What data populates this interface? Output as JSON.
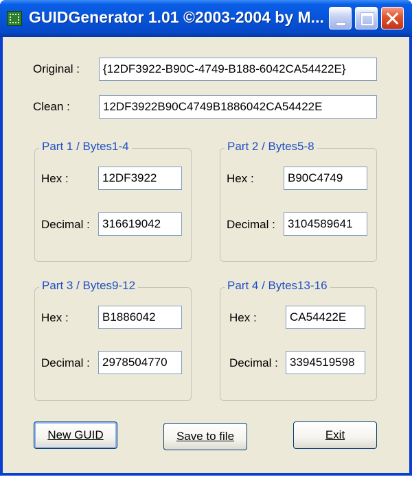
{
  "window": {
    "title": "GUIDGenerator 1.01 ©2003-2004 by M..."
  },
  "original": {
    "label": "Original :",
    "value": "{12DF3922-B90C-4749-B188-6042CA54422E}"
  },
  "clean": {
    "label": "Clean :",
    "value": "12DF3922B90C4749B1886042CA54422E"
  },
  "parts": [
    {
      "title": "Part 1 / Bytes1-4",
      "hex_label": "Hex :",
      "hex": "12DF3922",
      "dec_label": "Decimal :",
      "dec": "316619042"
    },
    {
      "title": "Part 2 / Bytes5-8",
      "hex_label": "Hex :",
      "hex": "B90C4749",
      "dec_label": "Decimal :",
      "dec": "3104589641"
    },
    {
      "title": "Part 3 / Bytes9-12",
      "hex_label": "Hex :",
      "hex": "B1886042",
      "dec_label": "Decimal :",
      "dec": "2978504770"
    },
    {
      "title": "Part 4 / Bytes13-16",
      "hex_label": "Hex :",
      "hex": "CA54422E",
      "dec_label": "Decimal :",
      "dec": "3394519598"
    }
  ],
  "buttons": {
    "new_guid": "New GUID",
    "save": "Save to file",
    "exit": "Exit"
  }
}
